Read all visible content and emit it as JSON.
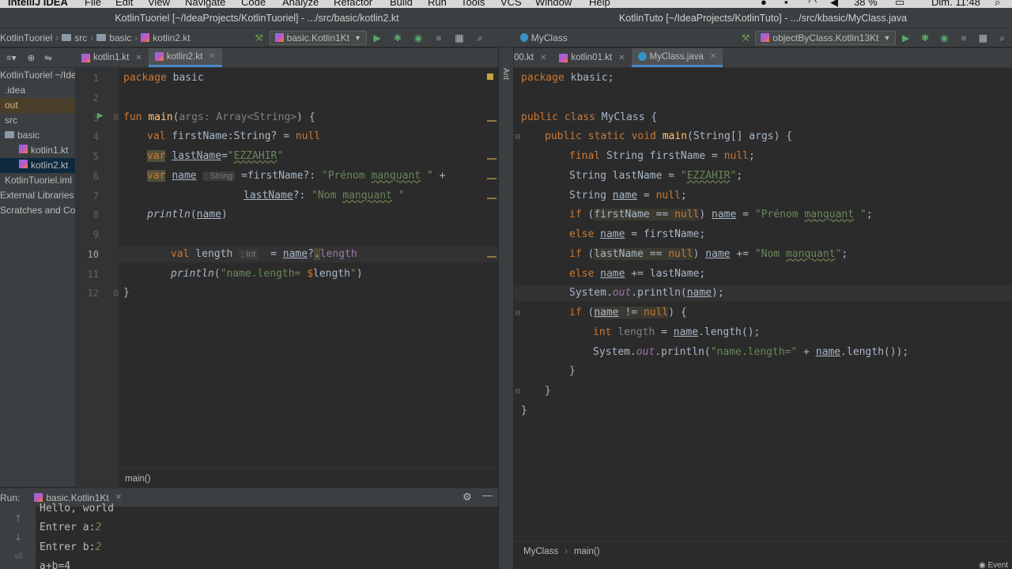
{
  "menubar": {
    "app": "IntelliJ IDEA",
    "items": [
      "File",
      "Edit",
      "View",
      "Navigate",
      "Code",
      "Analyze",
      "Refactor",
      "Build",
      "Run",
      "Tools",
      "VCS",
      "Window",
      "Help"
    ],
    "battery": "38 %",
    "clock": "Dim. 11:48"
  },
  "left": {
    "window_title": "KotlinTuoriel [~/IdeaProjects/KotlinTuoriel] - .../src/basic/kotlin2.kt",
    "breadcrumb": [
      "KotlinTuoriel",
      "src",
      "basic",
      "kotlin2.kt"
    ],
    "run_config": "basic.Kotlin1Kt",
    "tabs": [
      {
        "label": "kotlin1.kt",
        "active": false
      },
      {
        "label": "kotlin2.kt",
        "active": true
      }
    ],
    "project_tree": [
      {
        "label": "KotlinTuoriel ~/Ide",
        "indent": 0,
        "state": "normal"
      },
      {
        "label": ".idea",
        "indent": 0,
        "state": "normal"
      },
      {
        "label": "out",
        "indent": 0,
        "state": "out"
      },
      {
        "label": "src",
        "indent": 0,
        "state": "normal"
      },
      {
        "label": "basic",
        "indent": 1,
        "state": "normal"
      },
      {
        "label": "kotlin1.kt",
        "indent": 2,
        "state": "normal"
      },
      {
        "label": "kotlin2.kt",
        "indent": 2,
        "state": "sel"
      },
      {
        "label": "KotlinTuoriel.iml",
        "indent": 0,
        "state": "normal"
      },
      {
        "label": "External Libraries",
        "indent": 0,
        "state": "normal"
      },
      {
        "label": "Scratches and Con",
        "indent": 0,
        "state": "normal"
      }
    ],
    "line_numbers": [
      "1",
      "2",
      "3",
      "4",
      "5",
      "6",
      "7",
      "8",
      "9",
      "10",
      "11",
      "12"
    ],
    "status_crumb": "main()",
    "run_panel": {
      "label": "Run:",
      "config": "basic.Kotlin1Kt",
      "output": [
        {
          "text": "Hello, world",
          "input": ""
        },
        {
          "text": "Entrer a:",
          "input": "2"
        },
        {
          "text": "Entrer b:",
          "input": "2"
        },
        {
          "text": "a+b=4",
          "input": ""
        }
      ]
    }
  },
  "right": {
    "window_title": "KotlinTuto [~/IdeaProjects/KotlinTuto] - .../src/kbasic/MyClass.java",
    "breadcrumb": [
      "MyClass"
    ],
    "run_config": "objectByClass.Kotlin13Kt",
    "tabs": [
      {
        "label": "00.kt",
        "active": false
      },
      {
        "label": "kotlin01.kt",
        "active": false
      },
      {
        "label": "MyClass.java",
        "active": true
      }
    ],
    "status_crumb": [
      "MyClass",
      "main()"
    ],
    "event_log": "Event"
  },
  "side_tool": "Ant"
}
